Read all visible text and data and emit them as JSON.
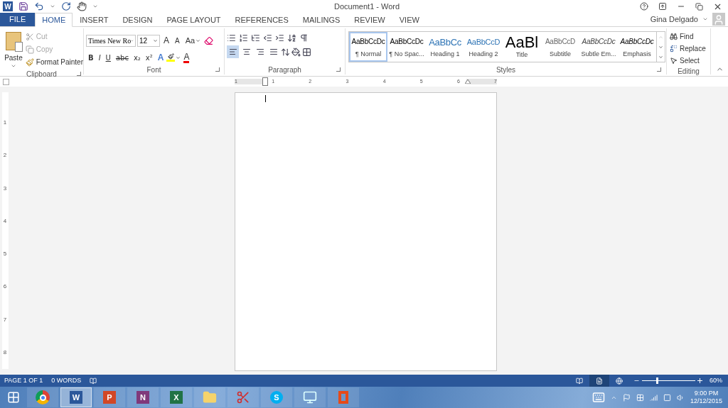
{
  "window": {
    "title": "Document1 - Word",
    "app_glyph": "W"
  },
  "tabs": [
    {
      "label": "FILE",
      "kind": "file",
      "selected": false
    },
    {
      "label": "HOME",
      "kind": "tab",
      "selected": true
    },
    {
      "label": "INSERT",
      "kind": "tab",
      "selected": false
    },
    {
      "label": "DESIGN",
      "kind": "tab",
      "selected": false
    },
    {
      "label": "PAGE LAYOUT",
      "kind": "tab",
      "selected": false
    },
    {
      "label": "REFERENCES",
      "kind": "tab",
      "selected": false
    },
    {
      "label": "MAILINGS",
      "kind": "tab",
      "selected": false
    },
    {
      "label": "REVIEW",
      "kind": "tab",
      "selected": false
    },
    {
      "label": "VIEW",
      "kind": "tab",
      "selected": false
    }
  ],
  "user": {
    "name": "Gina Delgado"
  },
  "clipboard": {
    "label": "Clipboard",
    "paste": "Paste",
    "items": [
      {
        "label": "Cut",
        "disabled": true
      },
      {
        "label": "Copy",
        "disabled": true
      },
      {
        "label": "Format Painter",
        "disabled": false
      }
    ]
  },
  "font": {
    "label": "Font",
    "font_name": "Times New Ro",
    "font_size": "12",
    "grow": "A",
    "shrink": "A",
    "change_case": "Aa",
    "formats": [
      "B",
      "I",
      "U",
      "abc",
      "x₂",
      "x²"
    ],
    "text_effects": "A",
    "font_color": "A"
  },
  "paragraph": {
    "label": "Paragraph",
    "alignments": [
      {
        "selected": true
      },
      {
        "selected": false
      },
      {
        "selected": false
      },
      {
        "selected": false
      }
    ]
  },
  "styles": {
    "label": "Styles",
    "items": [
      {
        "preview": "AaBbCcDc",
        "name": "¶ Normal",
        "selected": true
      },
      {
        "preview": "AaBbCcDc",
        "name": "¶ No Spac...",
        "selected": false
      },
      {
        "preview": "AaBbCc",
        "name": "Heading 1",
        "selected": false
      },
      {
        "preview": "AaBbCcD",
        "name": "Heading 2",
        "selected": false
      },
      {
        "preview": "AaBl",
        "name": "Title",
        "selected": false
      },
      {
        "preview": "AaBbCcD",
        "name": "Subtitle",
        "selected": false
      },
      {
        "preview": "AaBbCcDc",
        "name": "Subtle Em...",
        "selected": false
      },
      {
        "preview": "AaBbCcDc",
        "name": "Emphasis",
        "selected": false
      }
    ]
  },
  "editing": {
    "label": "Editing",
    "items": [
      {
        "label": "Find",
        "kind": "find"
      },
      {
        "label": "Replace",
        "kind": "replace"
      },
      {
        "label": "Select",
        "kind": "select"
      }
    ]
  },
  "ruler": {
    "labels": [
      "1",
      "1",
      "2",
      "3",
      "4",
      "5",
      "6",
      "7"
    ]
  },
  "vertical_ruler": {
    "labels": [
      "1",
      "2",
      "3",
      "4",
      "5",
      "6",
      "7",
      "8"
    ]
  },
  "status_bar": {
    "page": "PAGE 1 OF 1",
    "words": "0 WORDS",
    "views": [
      {
        "selected": false
      },
      {
        "selected": true
      },
      {
        "selected": false
      }
    ],
    "zoom": {
      "level": 0.28,
      "reading": "60%"
    }
  },
  "taskbar": {
    "apps": [
      {
        "kind": "chrome",
        "selected": false
      },
      {
        "kind": "word",
        "glyph": "W",
        "selected": true
      },
      {
        "kind": "powerpoint",
        "glyph": "P",
        "selected": false
      },
      {
        "kind": "onenote",
        "glyph": "N",
        "selected": false
      },
      {
        "kind": "excel",
        "glyph": "X",
        "selected": false
      },
      {
        "kind": "explorer",
        "selected": false
      },
      {
        "kind": "snipping",
        "selected": false
      },
      {
        "kind": "skype",
        "glyph": "S",
        "selected": false
      },
      {
        "kind": "control",
        "selected": false
      },
      {
        "kind": "office",
        "selected": false
      }
    ],
    "time": "9:00 PM",
    "date": "12/12/2015"
  }
}
